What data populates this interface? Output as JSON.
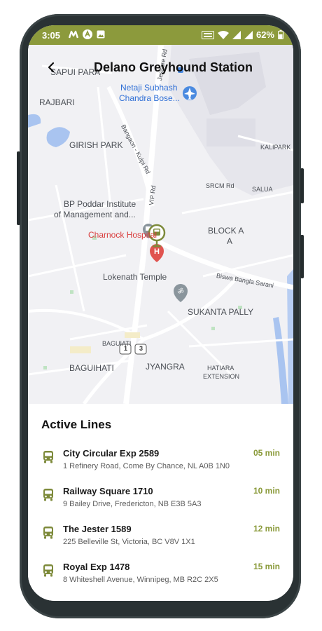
{
  "status_bar": {
    "time": "3:05",
    "battery": "62%",
    "left_icons": [
      "m-app-icon",
      "sync-icon",
      "image-icon"
    ],
    "right_icons": [
      "volte-icon",
      "wifi-icon",
      "signal-icon",
      "signal-icon",
      "battery-icon"
    ]
  },
  "header": {
    "title": "Delano Greyhound Station",
    "back_icon": "back-arrow-icon"
  },
  "map": {
    "labels": {
      "sapui_para": "SAPUI PARA",
      "rajbari": "RAJBARI",
      "girish_park": "GIRISH PARK",
      "netaji_line1": "Netaji Subhash",
      "netaji_line2": "Chandra Bose...",
      "kalipark": "KALIPARK",
      "srcm_rd": "SRCM Rd",
      "saluaa": "SALUA",
      "bp_poddar_line1": "BP Poddar Institute",
      "bp_poddar_line2": "of Management and...",
      "charnock": "Charnock Hospital",
      "block_a_line1": "BLOCK A",
      "block_a_line2": "A",
      "lokenath": "Lokenath Temple",
      "biswa": "Biswa Bangla Sarani",
      "sukanta": "SUKANTA PALLY",
      "baguiati_small": "BAGUIATI",
      "baguihati": "BAGUIHATI",
      "jyangra": "JYANGRA",
      "hatiara_line1": "HATIARA",
      "hatiara_line2": "EXTENSION",
      "bangaon_road": "Bangaon - Kulpi Rd",
      "vip_rd": "VIP Rd",
      "jessore_rd": "Jessore Rd",
      "shield1": "1",
      "shield3": "3"
    }
  },
  "sheet": {
    "title": "Active Lines",
    "lines": [
      {
        "name": "City Circular Exp 2589",
        "address": "1 Refinery Road, Come By Chance, NL A0B 1N0",
        "eta": "05 min",
        "icon": "bus-icon"
      },
      {
        "name": "Railway Square 1710",
        "address": "9 Bailey Drive, Fredericton, NB E3B 5A3",
        "eta": "10 min",
        "icon": "bus-icon"
      },
      {
        "name": "The Jester 1589",
        "address": "225 Belleville St, Victoria, BC V8V 1X1",
        "eta": "12 min",
        "icon": "bus-icon"
      },
      {
        "name": "Royal Exp 1478",
        "address": "8 Whiteshell Avenue, Winnipeg, MB R2C 2X5",
        "eta": "15 min",
        "icon": "bus-icon"
      }
    ]
  },
  "colors": {
    "accent": "#8c9a3c",
    "eta": "#8a9a3a",
    "bus_icon": "#7d8a3a",
    "phone_frame": "#2a3234",
    "map_background": "#f1f1f4",
    "hospital": "#d93c3c",
    "poi_blue": "#2f6fd6",
    "temple": "#8a959c"
  }
}
